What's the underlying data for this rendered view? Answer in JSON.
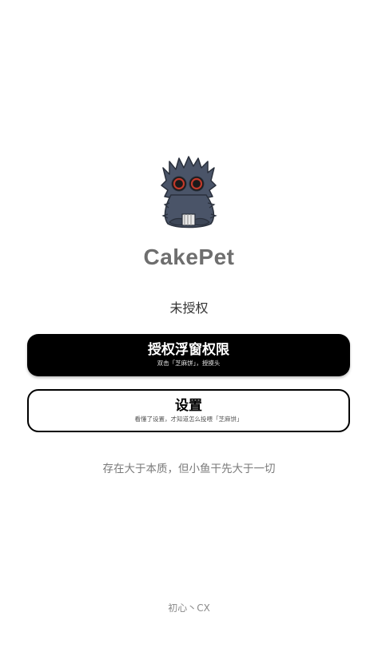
{
  "app": {
    "name": "CakePet",
    "status": "未授权",
    "mascot_icon": "fluffy-cat-icon"
  },
  "buttons": {
    "grant": {
      "label": "授权浮窗权限",
      "subtitle": "双击「芝麻饼」，授摸头"
    },
    "settings": {
      "label": "设置",
      "subtitle": "看懂了设置，才知道怎么投喂「芝麻饼」"
    }
  },
  "slogan": "存在大于本质，但小鱼干先大于一切",
  "footer": "初心丶CX",
  "colors": {
    "primary_button": "#000000",
    "app_name": "#6e6e6e",
    "cat_fur": "#4a5468",
    "cat_eyes": "#c0392b"
  }
}
